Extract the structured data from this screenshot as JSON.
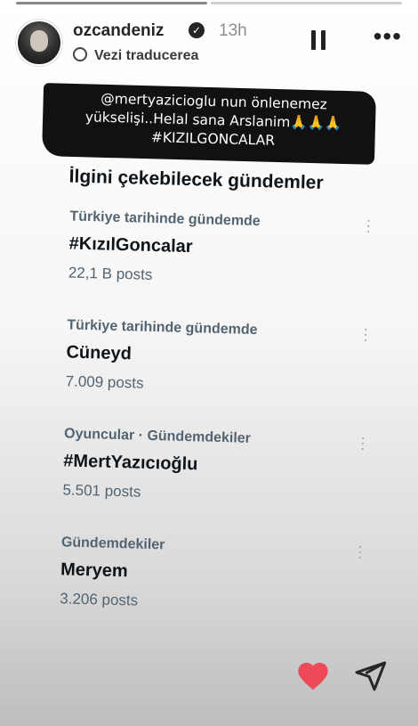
{
  "story": {
    "username": "ozcandeniz",
    "time": "13h",
    "translate_label": "Vezi traducerea",
    "caption_lines": [
      "@mertyazicioglu nun önlenemez",
      "yükselişi..Helal sana Arslanim🙏🙏🙏",
      "#KIZILGONCALAR"
    ]
  },
  "panel": {
    "title": "İlgini çekebilecek gündemler",
    "trends": [
      {
        "context": "Türkiye tarihinde gündemde",
        "name": "#KızılGoncalar",
        "count": "22,1 B posts"
      },
      {
        "context": "Türkiye tarihinde gündemde",
        "name": "Cüneyd",
        "count": "7.009 posts"
      },
      {
        "context": "Oyuncular · Gündemdekiler",
        "name": "#MertYazıcıoğlu",
        "count": "5.501 posts"
      },
      {
        "context": "Gündemdekiler",
        "name": "Meryem",
        "count": "3.206 posts"
      }
    ]
  },
  "colors": {
    "like": "#ed4956",
    "text": "#0f1419",
    "muted": "#536471"
  }
}
